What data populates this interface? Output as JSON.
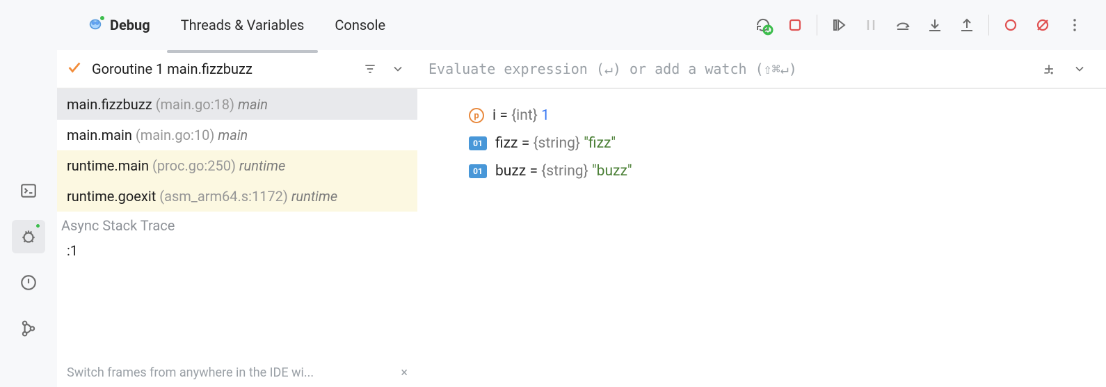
{
  "tabs": {
    "debug": "Debug",
    "threads": "Threads & Variables",
    "console": "Console"
  },
  "goroutine": {
    "label": "Goroutine 1 main.fizzbuzz"
  },
  "watch": {
    "placeholder": "Evaluate expression (↵) or add a watch (⇧⌘↵)"
  },
  "frames": [
    {
      "func": "main.fizzbuzz",
      "loc": "(main.go:18)",
      "mod": "main",
      "kind": "selected"
    },
    {
      "func": "main.main",
      "loc": "(main.go:10)",
      "mod": "main",
      "kind": "normal"
    },
    {
      "func": "runtime.main",
      "loc": "(proc.go:250)",
      "mod": "runtime",
      "kind": "lib"
    },
    {
      "func": "runtime.goexit",
      "loc": "(asm_arm64.s:1172)",
      "mod": "runtime",
      "kind": "lib"
    }
  ],
  "async": {
    "header": "Async Stack Trace",
    "row": ":1"
  },
  "hint": "Switch frames from anywhere in the IDE wi...",
  "vars": [
    {
      "badge": "p",
      "name": "i",
      "type": "{int}",
      "valKind": "num",
      "val": "1"
    },
    {
      "badge": "01",
      "name": "fizz",
      "type": "{string}",
      "valKind": "str",
      "val": "\"fizz\""
    },
    {
      "badge": "01",
      "name": "buzz",
      "type": "{string}",
      "valKind": "str",
      "val": "\"buzz\""
    }
  ]
}
